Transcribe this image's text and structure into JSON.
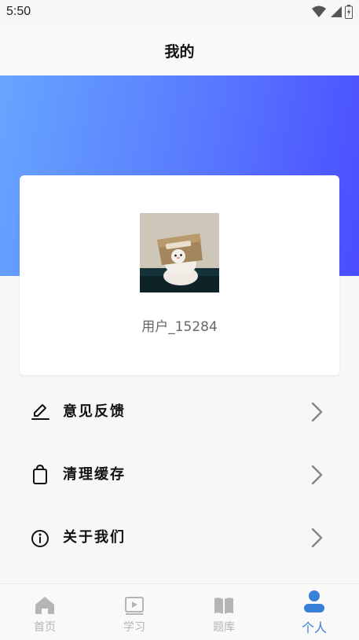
{
  "status_bar": {
    "time": "5:50"
  },
  "header": {
    "title": "我的"
  },
  "profile": {
    "username": "用户_15284"
  },
  "menu": {
    "items": [
      {
        "label": "意见反馈",
        "icon": "pen-icon"
      },
      {
        "label": "清理缓存",
        "icon": "trash-icon"
      },
      {
        "label": "关于我们",
        "icon": "info-icon"
      }
    ]
  },
  "tab_bar": {
    "tabs": [
      {
        "label": "首页",
        "icon": "home-icon"
      },
      {
        "label": "学习",
        "icon": "play-icon"
      },
      {
        "label": "题库",
        "icon": "book-icon"
      },
      {
        "label": "个人",
        "icon": "user-icon"
      }
    ],
    "active_index": 3
  },
  "colors": {
    "gradient_start": "#66a6ff",
    "gradient_end": "#4a4dff",
    "tab_active": "#3a7fd8",
    "tab_inactive": "#b5b5b5"
  }
}
